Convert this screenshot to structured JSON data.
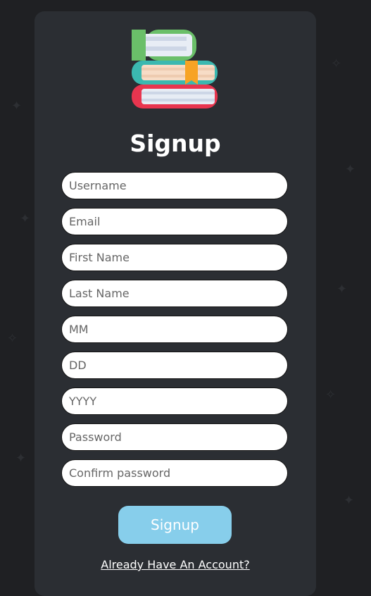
{
  "app": {
    "title": "Signup",
    "logo_icon": "books-stack-icon"
  },
  "form": {
    "fields": [
      {
        "placeholder": "Username",
        "value": ""
      },
      {
        "placeholder": "Email",
        "value": ""
      },
      {
        "placeholder": "First Name",
        "value": ""
      },
      {
        "placeholder": "Last Name",
        "value": ""
      },
      {
        "placeholder": "MM",
        "value": ""
      },
      {
        "placeholder": "DD",
        "value": ""
      },
      {
        "placeholder": "YYYY",
        "value": ""
      },
      {
        "placeholder": "Password",
        "value": ""
      },
      {
        "placeholder": "Confirm password",
        "value": ""
      }
    ],
    "submit_label": "Signup",
    "login_link": "Already Have An Account?"
  },
  "colors": {
    "page_background": "#1f2023",
    "card_background": "#2b2e33",
    "button_background": "#87ceeb",
    "text_primary": "#ffffff"
  }
}
